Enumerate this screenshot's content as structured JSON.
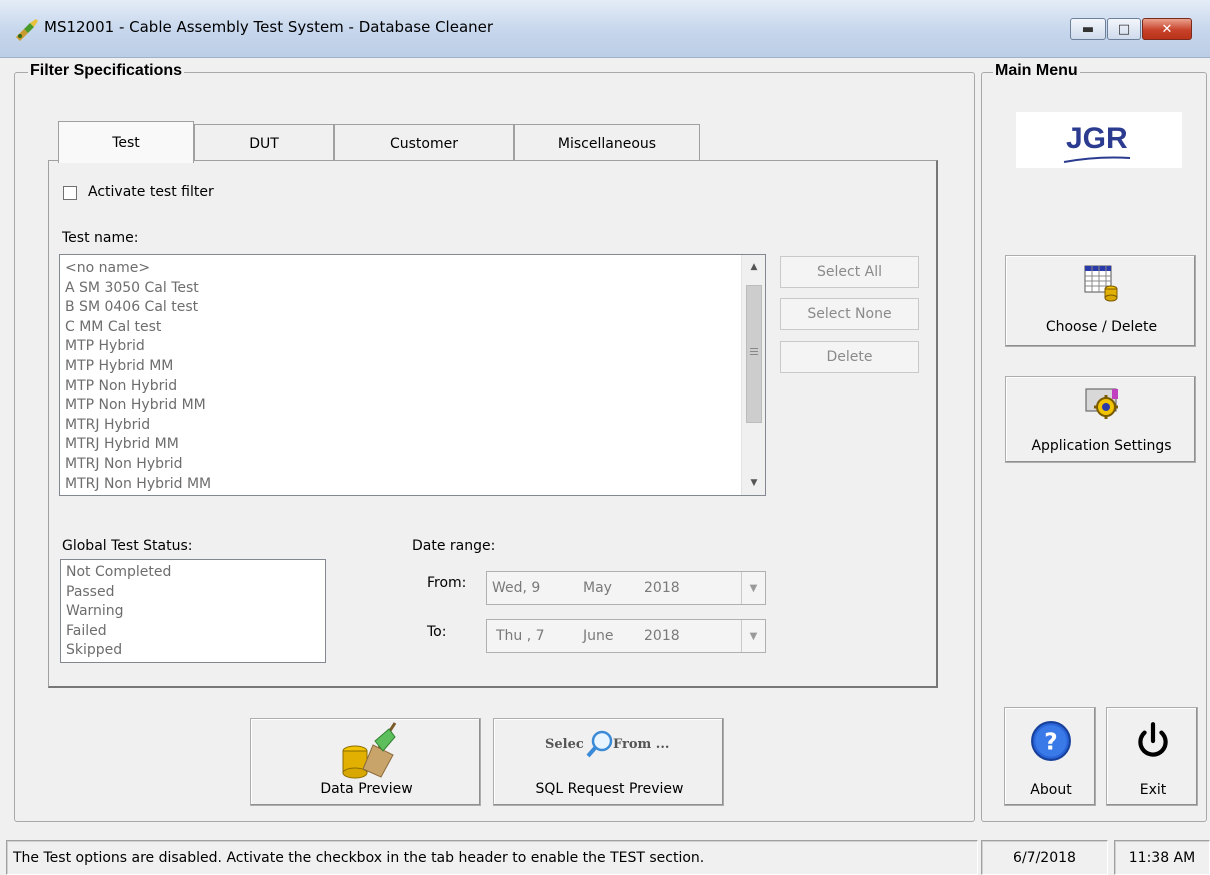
{
  "window": {
    "title": "MS12001 - Cable Assembly Test System - Database Cleaner",
    "minimize_glyph": "▬",
    "maximize_glyph": "□",
    "close_glyph": "✕"
  },
  "filter": {
    "group_label": "Filter Specifications",
    "tabs": [
      {
        "label": "Test",
        "active": true
      },
      {
        "label": "DUT",
        "active": false
      },
      {
        "label": "Customer",
        "active": false
      },
      {
        "label": "Miscellaneous",
        "active": false
      }
    ],
    "activate_label": "Activate test filter",
    "activate_checked": false,
    "test_name_label": "Test name:",
    "test_names": [
      "<no name>",
      "A SM 3050 Cal Test",
      "B SM 0406 Cal test",
      "C MM Cal test",
      "MTP Hybrid",
      "MTP Hybrid MM",
      "MTP Non Hybrid",
      "MTP Non Hybrid MM",
      "MTRJ Hybrid",
      "MTRJ Hybrid MM",
      "MTRJ Non Hybrid",
      "MTRJ Non Hybrid MM"
    ],
    "buttons": {
      "select_all": "Select All",
      "select_none": "Select None",
      "delete": "Delete"
    },
    "global_status_label": "Global Test Status:",
    "statuses": [
      "Not Completed",
      "Passed",
      "Warning",
      "Failed",
      "Skipped"
    ],
    "date_range_label": "Date range:",
    "from_label": "From:",
    "to_label": "To:",
    "from_date": {
      "day": "Wed, 9",
      "month": "May",
      "year": "2018"
    },
    "to_date": {
      "day": "Thu , 7",
      "month": "June",
      "year": "2018"
    }
  },
  "actions": {
    "data_preview": "Data Preview",
    "sql_preview": "SQL Request Preview",
    "sql_icon_text_left": "Selec",
    "sql_icon_text_right": "From ..."
  },
  "main_menu": {
    "group_label": "Main Menu",
    "logo_text": "JGR",
    "choose_delete": "Choose / Delete",
    "app_settings": "Application Settings",
    "about": "About",
    "exit": "Exit"
  },
  "statusbar": {
    "message": "The Test options are disabled. Activate the checkbox in the tab header to enable the TEST section.",
    "date": "6/7/2018",
    "time": "11:38 AM"
  },
  "colors": {
    "accent_blue": "#1a57c8",
    "logo_blue": "#2b3b8f",
    "close_red": "#c8432b"
  }
}
